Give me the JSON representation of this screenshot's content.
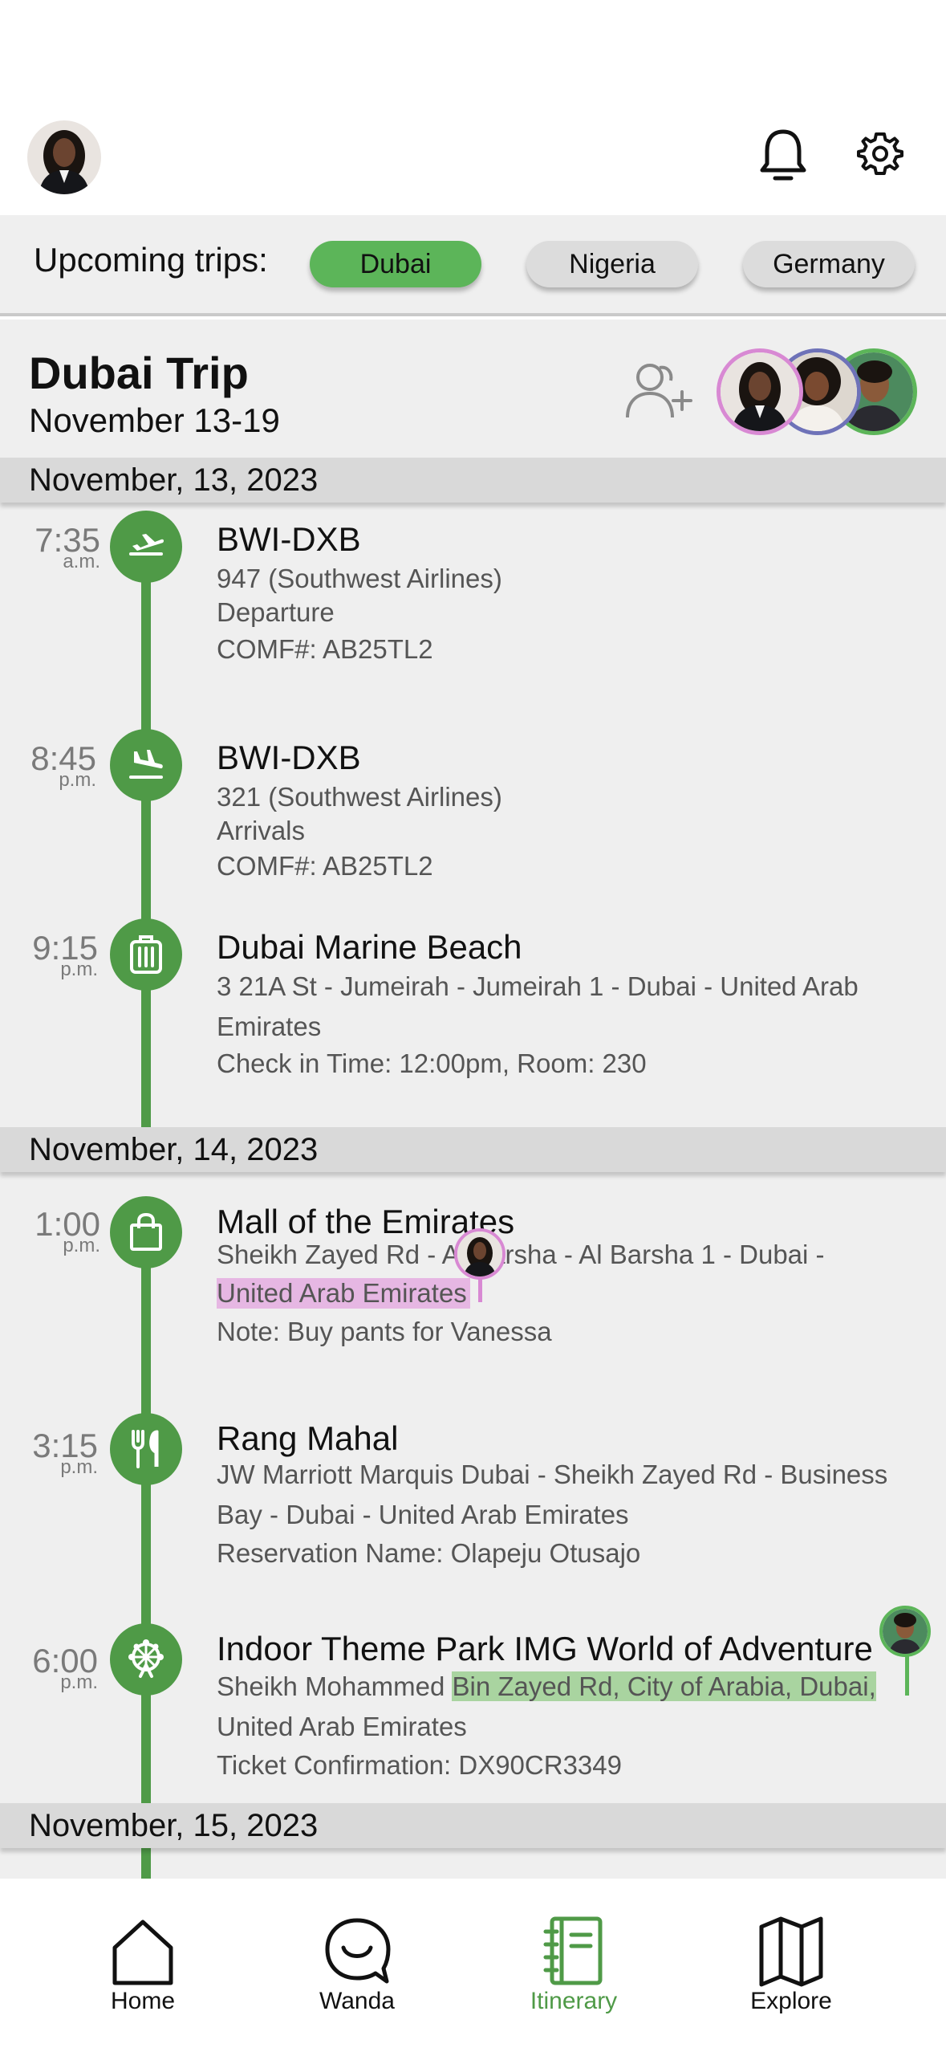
{
  "upcoming": {
    "label": "Upcoming trips:",
    "trips": [
      "Dubai",
      "Nigeria",
      "Germany"
    ],
    "selected": "Dubai"
  },
  "trip": {
    "title": "Dubai Trip",
    "dates": "November 13-19"
  },
  "days": [
    {
      "date": "November, 13, 2023",
      "events": [
        {
          "time": "7:35",
          "ampm": "a.m.",
          "icon": "plane-takeoff-icon",
          "title": "BWI-DXB",
          "lines": [
            "947 (Southwest Airlines)",
            "Departure",
            "COMF#: AB25TL2"
          ]
        },
        {
          "time": "8:45",
          "ampm": "p.m.",
          "icon": "plane-landing-icon",
          "title": "BWI-DXB",
          "lines": [
            "321 (Southwest Airlines)",
            "Arrivals",
            "COMF#: AB25TL2"
          ]
        },
        {
          "time": "9:15",
          "ampm": "p.m.",
          "icon": "luggage-icon",
          "title": "Dubai Marine Beach",
          "lines": [
            "3 21A St - Jumeirah - Jumeirah 1 - Dubai - United Arab",
            "Emirates",
            "Check in Time: 12:00pm, Room: 230"
          ]
        }
      ]
    },
    {
      "date": "November, 14, 2023",
      "events": [
        {
          "time": "1:00",
          "ampm": "p.m.",
          "icon": "shopping-bag-icon",
          "title": "Mall of the Emirates",
          "lines": [
            "Sheikh Zayed Rd - Al Barsha - Al Barsha 1 - Dubai -",
            "United Arab Emirates",
            "Note: Buy pants for Vanessa"
          ]
        },
        {
          "time": "3:15",
          "ampm": "p.m.",
          "icon": "restaurant-icon",
          "title": "Rang Mahal",
          "lines": [
            "JW Marriott Marquis Dubai - Sheikh Zayed Rd - Business",
            "Bay - Dubai - United Arab Emirates",
            "Reservation Name: Olapeju Otusajo"
          ]
        },
        {
          "time": "6:00",
          "ampm": "p.m.",
          "icon": "ferris-wheel-icon",
          "title": "Indoor Theme Park IMG World of Adventure",
          "lines": [
            "Sheikh Mohammed ",
            "Bin Zayed Rd, City of Arabia, Dubai,",
            "United Arab Emirates",
            "Ticket Confirmation: DX90CR3349"
          ]
        }
      ]
    },
    {
      "date": "November, 15, 2023",
      "events": []
    }
  ],
  "nav": [
    {
      "label": "Home",
      "icon": "home-icon"
    },
    {
      "label": "Wanda",
      "icon": "chat-bubble-icon"
    },
    {
      "label": "Itinerary",
      "icon": "notebook-icon",
      "active": true
    },
    {
      "label": "Explore",
      "icon": "map-icon"
    }
  ],
  "colors": {
    "accent": "#4f9a47",
    "pill_active": "#5cb559",
    "highlight_pink": "#e6b7e3",
    "highlight_green": "#a9d4a0",
    "avatar_pink": "#d889d3",
    "avatar_purple": "#6e72b8",
    "avatar_green": "#5cb559"
  }
}
